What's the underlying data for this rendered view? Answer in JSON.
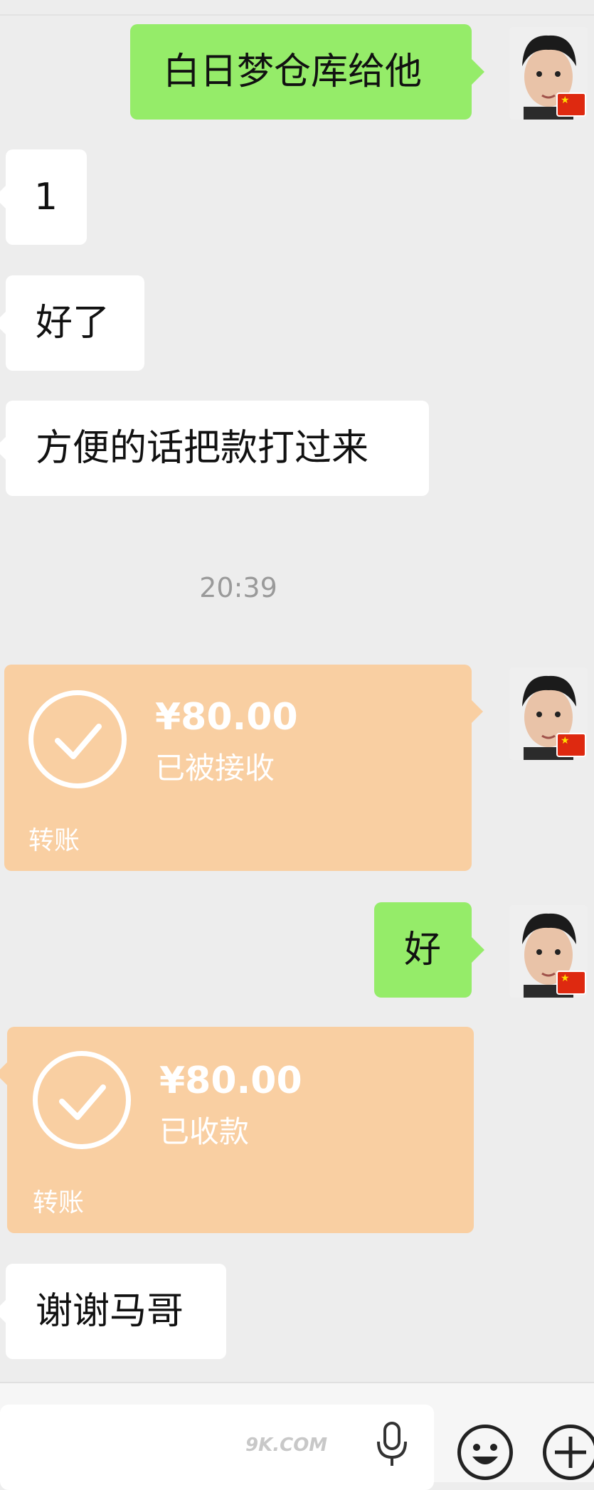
{
  "messages": {
    "m1": "白日梦仓库给他",
    "m2": "1",
    "m3": "好了",
    "m4": "方便的话把款打过来",
    "time": "20:39",
    "m5": "好",
    "m6": "谢谢马哥"
  },
  "transfer1": {
    "amount": "¥80.00",
    "status": "已被接收",
    "kind": "转账"
  },
  "transfer2": {
    "amount": "¥80.00",
    "status": "已收款",
    "kind": "转账"
  },
  "watermark": "9K.COM",
  "colors": {
    "green_bubble": "#95ec69",
    "white_bubble": "#ffffff",
    "transfer": "#f9cfa2",
    "background": "#ededed"
  },
  "icons": {
    "voice": "microphone-icon",
    "emoji": "smiley-icon",
    "more": "plus-icon",
    "flag": "china-flag-icon"
  }
}
